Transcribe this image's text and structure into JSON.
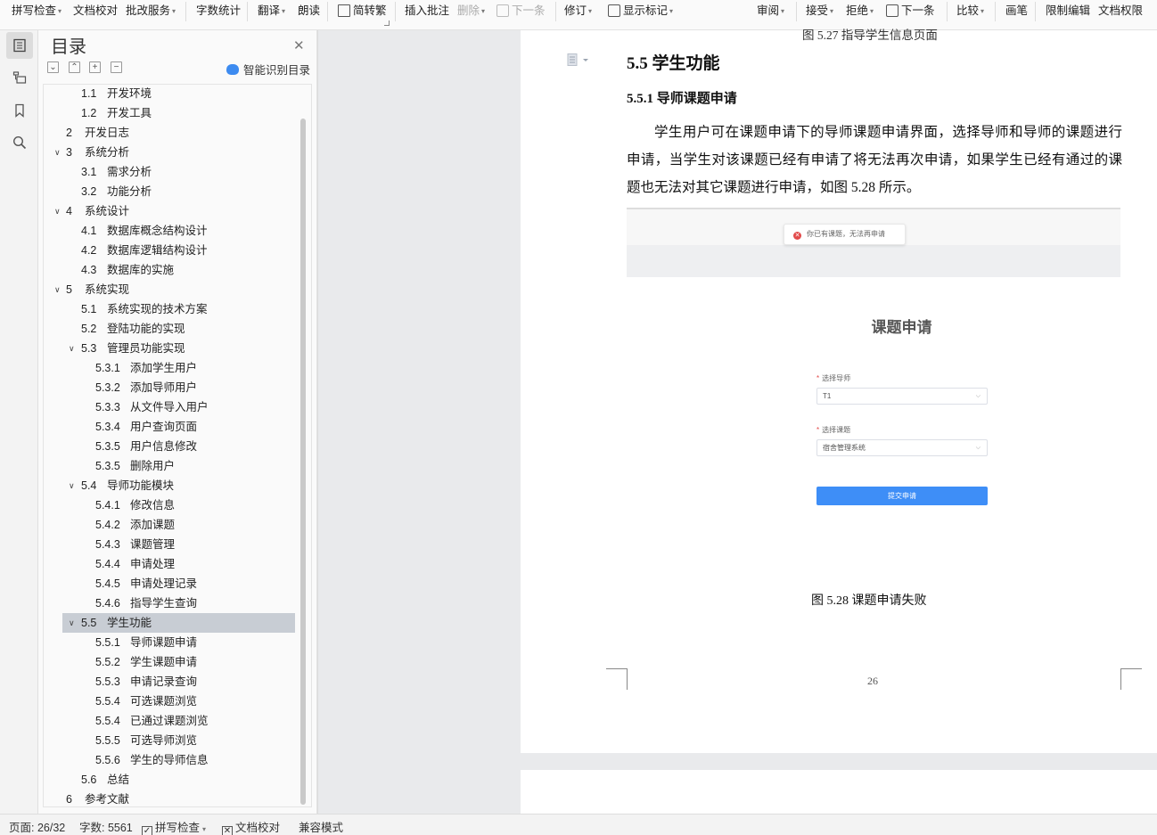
{
  "ribbon": {
    "spell_check": "拼写检查",
    "doc_proof": "文档校对",
    "revise_service": "批改服务",
    "word_count": "字数统计",
    "translate": "翻译",
    "read_aloud": "朗读",
    "simp_trad": "简转繁",
    "insert_comment": "插入批注",
    "delete": "删除",
    "next_item": "下一条",
    "track_changes": "修订",
    "show_markup": "显示标记",
    "review": "审阅",
    "accept": "接受",
    "reject": "拒绝",
    "next_change": "下一条",
    "compare": "比较",
    "pen": "画笔",
    "restrict_edit": "限制编辑",
    "doc_permission": "文档权限"
  },
  "toc": {
    "title": "目录",
    "smart_detect": "智能识别目录",
    "items": [
      {
        "num": "1.1",
        "text": "开发环境",
        "level": 2,
        "chevron": ""
      },
      {
        "num": "1.2",
        "text": "开发工具",
        "level": 2,
        "chevron": ""
      },
      {
        "num": "2",
        "text": "开发日志",
        "level": 1,
        "chevron": ""
      },
      {
        "num": "3",
        "text": "系统分析",
        "level": 1,
        "chevron": "open"
      },
      {
        "num": "3.1",
        "text": "需求分析",
        "level": 2,
        "chevron": ""
      },
      {
        "num": "3.2",
        "text": "功能分析",
        "level": 2,
        "chevron": ""
      },
      {
        "num": "4",
        "text": "系统设计",
        "level": 1,
        "chevron": "open"
      },
      {
        "num": "4.1",
        "text": "数据库概念结构设计",
        "level": 2,
        "chevron": ""
      },
      {
        "num": "4.2",
        "text": "数据库逻辑结构设计",
        "level": 2,
        "chevron": ""
      },
      {
        "num": "4.3",
        "text": "数据库的实施",
        "level": 2,
        "chevron": ""
      },
      {
        "num": "5",
        "text": "系统实现",
        "level": 1,
        "chevron": "open"
      },
      {
        "num": "5.1",
        "text": "系统实现的技术方案",
        "level": 2,
        "chevron": ""
      },
      {
        "num": "5.2",
        "text": "登陆功能的实现",
        "level": 2,
        "chevron": ""
      },
      {
        "num": "5.3",
        "text": "管理员功能实现",
        "level": 2,
        "chevron": "open"
      },
      {
        "num": "5.3.1",
        "text": "添加学生用户",
        "level": 3,
        "chevron": ""
      },
      {
        "num": "5.3.2",
        "text": "添加导师用户",
        "level": 3,
        "chevron": ""
      },
      {
        "num": "5.3.3",
        "text": "从文件导入用户",
        "level": 3,
        "chevron": ""
      },
      {
        "num": "5.3.4",
        "text": "用户查询页面",
        "level": 3,
        "chevron": ""
      },
      {
        "num": "5.3.5",
        "text": "用户信息修改",
        "level": 3,
        "chevron": ""
      },
      {
        "num": "5.3.5",
        "text": "删除用户",
        "level": 3,
        "chevron": ""
      },
      {
        "num": "5.4",
        "text": "导师功能模块",
        "level": 2,
        "chevron": "open"
      },
      {
        "num": "5.4.1",
        "text": "修改信息",
        "level": 3,
        "chevron": ""
      },
      {
        "num": "5.4.2",
        "text": "添加课题",
        "level": 3,
        "chevron": ""
      },
      {
        "num": "5.4.3",
        "text": "课题管理",
        "level": 3,
        "chevron": ""
      },
      {
        "num": "5.4.4",
        "text": "申请处理",
        "level": 3,
        "chevron": ""
      },
      {
        "num": "5.4.5",
        "text": "申请处理记录",
        "level": 3,
        "chevron": ""
      },
      {
        "num": "5.4.6",
        "text": "指导学生查询",
        "level": 3,
        "chevron": ""
      },
      {
        "num": "5.5",
        "text": "学生功能",
        "level": 2,
        "chevron": "open",
        "selected": true
      },
      {
        "num": "5.5.1",
        "text": "导师课题申请",
        "level": 3,
        "chevron": ""
      },
      {
        "num": "5.5.2",
        "text": "学生课题申请",
        "level": 3,
        "chevron": ""
      },
      {
        "num": "5.5.3",
        "text": "申请记录查询",
        "level": 3,
        "chevron": ""
      },
      {
        "num": "5.5.4",
        "text": "可选课题浏览",
        "level": 3,
        "chevron": ""
      },
      {
        "num": "5.5.4",
        "text": "已通过课题浏览",
        "level": 3,
        "chevron": ""
      },
      {
        "num": "5.5.5",
        "text": "可选导师浏览",
        "level": 3,
        "chevron": ""
      },
      {
        "num": "5.5.6",
        "text": "学生的导师信息",
        "level": 3,
        "chevron": ""
      },
      {
        "num": "5.6",
        "text": "总结",
        "level": 2,
        "chevron": ""
      },
      {
        "num": "6",
        "text": "参考文献",
        "level": 1,
        "chevron": ""
      }
    ]
  },
  "document": {
    "prev_caption": "图 5.27  指导学生信息页面",
    "heading_55": "5.5    学生功能",
    "heading_551": "5.5.1    导师课题申请",
    "body": "学生用户可在课题申请下的导师课题申请界面，选择导师和导师的课题进行申请，当学生对该课题已经有申请了将无法再次申请，如果学生已经有通过的课题也无法对其它课题进行申请，如图 5.28 所示。",
    "figure": {
      "toast": "你已有课题，无法再申请",
      "form_title": "课题申请",
      "tutor_label": "选择导师",
      "tutor_value": "T1",
      "topic_label": "选择课题",
      "topic_value": "宿舍管理系统",
      "submit": "提交申请"
    },
    "fig_caption": "图 5.28    课题申请失败",
    "page_number": "26"
  },
  "status": {
    "page": "页面: 26/32",
    "words": "字数: 5561",
    "spell_check": "拼写检查",
    "doc_proof": "文档校对",
    "compat_mode": "兼容模式"
  },
  "colors": {
    "accent": "#3e8ef7",
    "selected_row": "#c8cdd4",
    "error": "#e24a4a"
  }
}
